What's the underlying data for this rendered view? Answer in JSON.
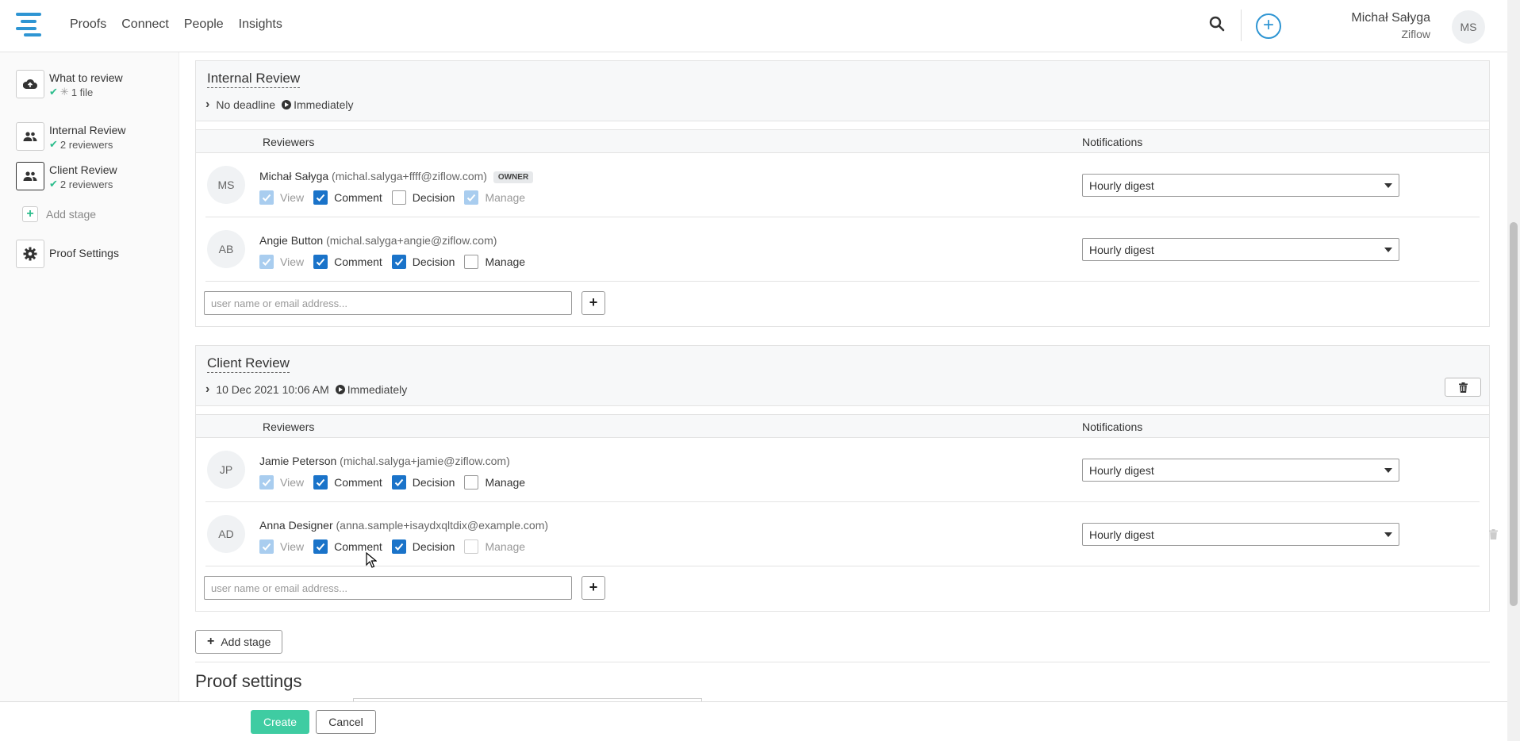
{
  "nav": {
    "items": [
      "Proofs",
      "Connect",
      "People",
      "Insights"
    ]
  },
  "user": {
    "name": "Michał Sałyga",
    "org": "Ziflow",
    "initials": "MS"
  },
  "sidebar": {
    "what_to_review": {
      "title": "What to review",
      "sub": "1 file"
    },
    "internal_review": {
      "title": "Internal Review",
      "sub": "2 reviewers"
    },
    "client_review": {
      "title": "Client Review",
      "sub": "2 reviewers"
    },
    "add_stage": "Add stage",
    "proof_settings": "Proof Settings"
  },
  "stages": [
    {
      "title": "Internal Review",
      "deadline": "No deadline",
      "start": "Immediately",
      "reviewers_header": "Reviewers",
      "notifications_header": "Notifications",
      "reviewers": [
        {
          "initials": "MS",
          "name": "Michał Sałyga",
          "email": "(michal.salyga+ffff@ziflow.com)",
          "badge": "OWNER",
          "notification": "Hourly digest"
        },
        {
          "initials": "AB",
          "name": "Angie Button",
          "email": "(michal.salyga+angie@ziflow.com)",
          "badge": "",
          "notification": "Hourly digest"
        }
      ],
      "add_placeholder": "user name or email address..."
    },
    {
      "title": "Client Review",
      "deadline": "10 Dec 2021 10:06 AM",
      "start": "Immediately",
      "reviewers_header": "Reviewers",
      "notifications_header": "Notifications",
      "reviewers": [
        {
          "initials": "JP",
          "name": "Jamie Peterson",
          "email": "(michal.salyga+jamie@ziflow.com)",
          "badge": "",
          "notification": "Hourly digest"
        },
        {
          "initials": "AD",
          "name": "Anna Designer",
          "email": "(anna.sample+isaydxqltdix@example.com)",
          "badge": "",
          "notification": "Hourly digest"
        }
      ],
      "add_placeholder": "user name or email address..."
    }
  ],
  "perm_labels": {
    "view": "View",
    "comment": "Comment",
    "decision": "Decision",
    "manage": "Manage"
  },
  "add_stage_button": "Add stage",
  "proof_settings_title": "Proof settings",
  "footer": {
    "create": "Create",
    "cancel": "Cancel"
  },
  "colors": {
    "accent": "#2e95d3",
    "check_on": "#1a73c9",
    "success": "#3fcca2"
  }
}
